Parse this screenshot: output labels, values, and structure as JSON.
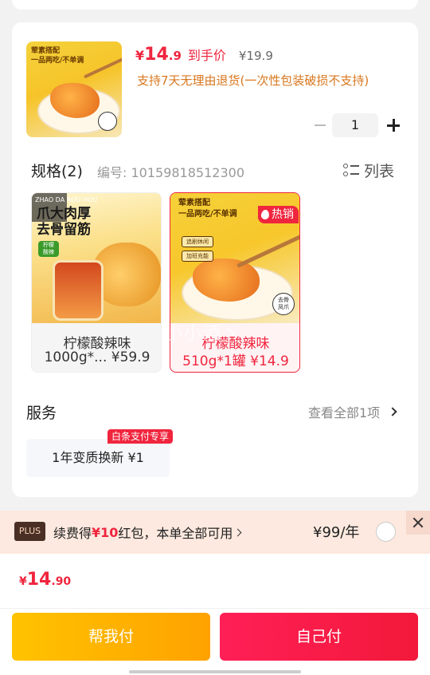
{
  "product": {
    "price_currency": "¥",
    "price_int": "14",
    "price_dec": ".9",
    "daoshou_label": "到手价",
    "original_price": "¥19.9",
    "refund_policy": "支持7天无理由退货(一次性包装破损不支持)",
    "thumb_tag": "荤素搭配\n一品两吃/不单调",
    "quantity": "1"
  },
  "spec": {
    "title": "规格(2)",
    "code": "编号: 10159818512300",
    "list_label": "列表",
    "hot_badge": "热销",
    "variants": [
      {
        "line1": "柠檬酸辣味",
        "line2": "1000g*... ¥59.9",
        "headline": "爪大肉厚\n去骨留筋",
        "small": "ZHAO DA ROU HOU",
        "chip": "柠檬\n酸辣"
      },
      {
        "line1": "柠檬酸辣味",
        "line2": "510g*1罐 ¥14.9",
        "tag": "荤素搭配\n一品两吃/不单调",
        "chip1": "追剧休闲",
        "chip2": "加班充能",
        "seal": "去骨\n凤爪"
      }
    ],
    "watermark": "小小酒丶"
  },
  "service": {
    "title": "服务",
    "more": "查看全部1项",
    "flag": "白条支付专享",
    "chip": "1年变质换新 ¥1"
  },
  "plus": {
    "logo": "PLUS",
    "text_prefix": "续费得",
    "text_red": "¥10",
    "text_suffix": "红包，本单全部可用",
    "price": "¥99/年"
  },
  "bottom": {
    "total_currency": "¥",
    "total_int": "14",
    "total_dec": ".90",
    "help_pay": "帮我付",
    "self_pay": "自己付"
  }
}
